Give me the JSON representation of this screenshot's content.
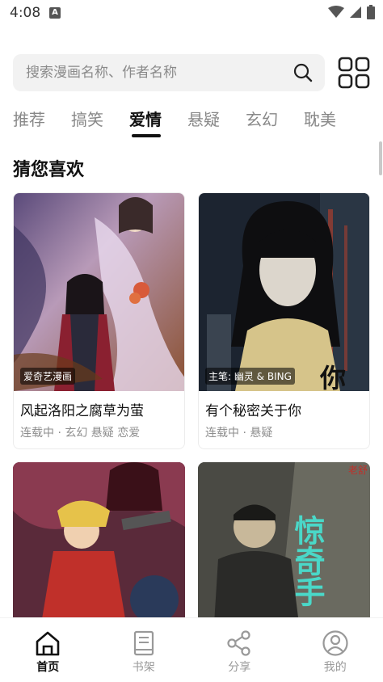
{
  "status_bar": {
    "time": "4:08",
    "notification_badge": "A"
  },
  "search": {
    "placeholder": "搜索漫画名称、作者名称"
  },
  "tabs": [
    {
      "label": "推荐",
      "active": false
    },
    {
      "label": "搞笑",
      "active": false
    },
    {
      "label": "爱情",
      "active": true
    },
    {
      "label": "悬疑",
      "active": false
    },
    {
      "label": "玄幻",
      "active": false
    },
    {
      "label": "耽美",
      "active": false
    }
  ],
  "section": {
    "title": "猜您喜欢"
  },
  "comics": [
    {
      "cover_tag": "爱奇艺漫画",
      "title": "风起洛阳之腐草为萤",
      "meta": "连载中 · 玄幻 悬疑 恋爱"
    },
    {
      "cover_tag": "主笔: 幽灵 & BING",
      "title": "有个秘密关于你",
      "meta": "连载中 · 悬疑",
      "cover_text": "你"
    },
    {
      "cover_tag": "",
      "title": "",
      "meta": ""
    },
    {
      "cover_tag": "",
      "title": "",
      "meta": "",
      "cover_text": "惊奇手",
      "cover_subtext": "老舒"
    }
  ],
  "bottom_nav": [
    {
      "label": "首页",
      "icon": "home-icon",
      "active": true
    },
    {
      "label": "书架",
      "icon": "book-icon",
      "active": false
    },
    {
      "label": "分享",
      "icon": "share-icon",
      "active": false
    },
    {
      "label": "我的",
      "icon": "profile-icon",
      "active": false
    }
  ],
  "colors": {
    "accent": "#111111",
    "inactive": "#999999",
    "search_bg": "#f2f2f2"
  }
}
